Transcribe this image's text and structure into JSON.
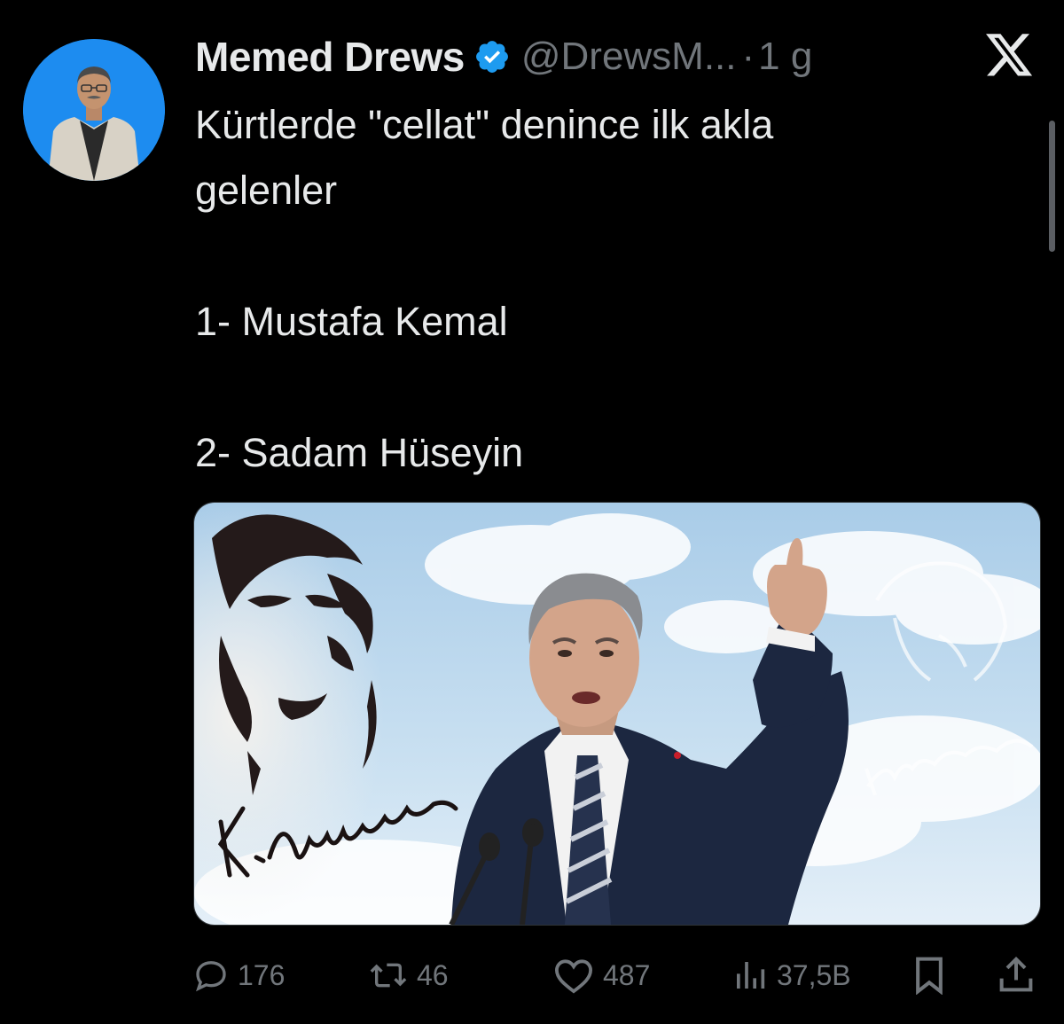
{
  "tweet": {
    "display_name": "Memed Drews",
    "handle": "@DrewsM...",
    "separator": "·",
    "time": "1 g",
    "verified": true,
    "text_lines": [
      "Kürtlerde \"cellat\" denince ilk akla",
      "gelenler",
      "1- Mustafa Kemal",
      "2- Sadam Hüseyin"
    ],
    "media": {
      "signature_left": "K.Atatürk",
      "signature_right": "K.Atatürk"
    }
  },
  "actions": {
    "replies": "176",
    "retweets": "46",
    "likes": "487",
    "views": "37,5B"
  },
  "icons": {
    "logo": "x-logo-icon",
    "verified": "verified-badge-icon",
    "reply": "reply-icon",
    "retweet": "retweet-icon",
    "like": "heart-icon",
    "views": "views-icon",
    "bookmark": "bookmark-icon",
    "share": "share-icon"
  },
  "colors": {
    "background": "#000000",
    "text": "#e7e9ea",
    "secondary": "#71767b",
    "verified_blue": "#1d9bf0",
    "avatar_bg": "#1d8cf0"
  }
}
